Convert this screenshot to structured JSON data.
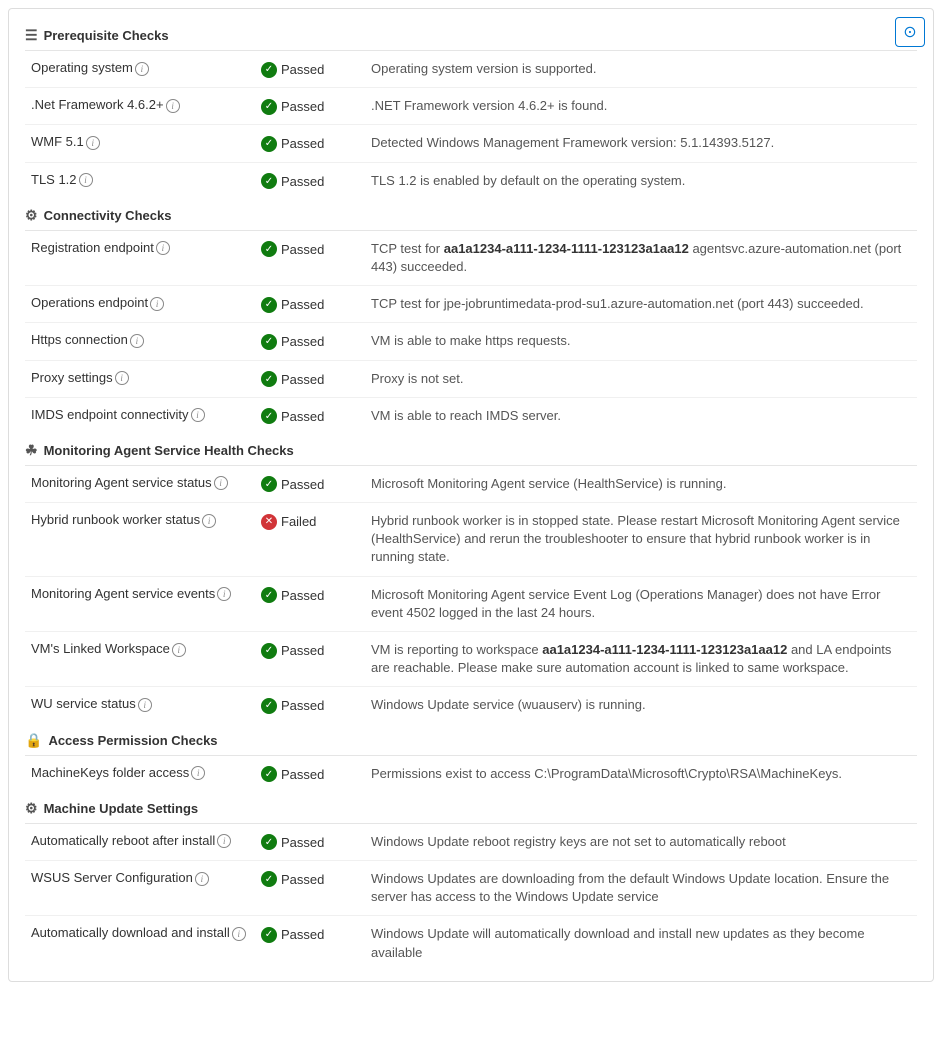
{
  "title": "Prerequisite Checks",
  "capture_button_label": "📷",
  "sections": [
    {
      "id": "prerequisite",
      "icon": "≡",
      "label": "Prerequisite Checks",
      "rows": [
        {
          "name": "Operating system",
          "info": true,
          "status": "Passed",
          "passed": true,
          "description": "Operating system version is supported."
        },
        {
          "name": ".Net Framework 4.6.2+",
          "info": true,
          "status": "Passed",
          "passed": true,
          "description": ".NET Framework version 4.6.2+ is found."
        },
        {
          "name": "WMF 5.1",
          "info": true,
          "status": "Passed",
          "passed": true,
          "description": "Detected Windows Management Framework version: 5.1.14393.5127."
        },
        {
          "name": "TLS 1.2",
          "info": true,
          "status": "Passed",
          "passed": true,
          "description": "TLS 1.2 is enabled by default on the operating system."
        }
      ]
    },
    {
      "id": "connectivity",
      "icon": "🔗",
      "label": "Connectivity Checks",
      "rows": [
        {
          "name": "Registration endpoint",
          "info": true,
          "status": "Passed",
          "passed": true,
          "description": "TCP test for aa1a1234-a111-1234-1111-123123a1aa12 agentsvc.azure-automation.net (port 443) succeeded.",
          "boldParts": [
            "aa1a1234-a111-1234-1111-123123a1aa12"
          ]
        },
        {
          "name": "Operations endpoint",
          "info": true,
          "status": "Passed",
          "passed": true,
          "description": "TCP test for jpe-jobruntimedata-prod-su1.azure-automation.net (port 443) succeeded."
        },
        {
          "name": "Https connection",
          "info": true,
          "status": "Passed",
          "passed": true,
          "description": "VM is able to make https requests."
        },
        {
          "name": "Proxy settings",
          "info": true,
          "status": "Passed",
          "passed": true,
          "description": "Proxy is not set."
        },
        {
          "name": "IMDS endpoint connectivity",
          "info": true,
          "status": "Passed",
          "passed": true,
          "description": "VM is able to reach IMDS server."
        }
      ]
    },
    {
      "id": "monitoring",
      "icon": "⚙",
      "label": "Monitoring Agent Service Health Checks",
      "rows": [
        {
          "name": "Monitoring Agent service status",
          "info": true,
          "status": "Passed",
          "passed": true,
          "description": "Microsoft Monitoring Agent service (HealthService) is running."
        },
        {
          "name": "Hybrid runbook worker status",
          "info": true,
          "status": "Failed",
          "passed": false,
          "description": "Hybrid runbook worker is in stopped state. Please restart Microsoft Monitoring Agent service (HealthService) and rerun the troubleshooter to ensure that hybrid runbook worker is in running state."
        },
        {
          "name": "Monitoring Agent service events",
          "info": true,
          "status": "Passed",
          "passed": true,
          "description": "Microsoft Monitoring Agent service Event Log (Operations Manager) does not have Error event 4502 logged in the last 24 hours."
        },
        {
          "name": "VM's Linked Workspace",
          "info": true,
          "status": "Passed",
          "passed": true,
          "description": "VM is reporting to workspace aa1a1234-a111-1234-1111-123123a1aa12 and LA endpoints are reachable. Please make sure automation account is linked to same workspace.",
          "boldParts": [
            "aa1a1234-a111-1234-1111-123123a1aa12"
          ]
        },
        {
          "name": "WU service status",
          "info": true,
          "status": "Passed",
          "passed": true,
          "description": "Windows Update service (wuauserv) is running."
        }
      ]
    },
    {
      "id": "access",
      "icon": "🔒",
      "label": "Access Permission Checks",
      "rows": [
        {
          "name": "MachineKeys folder access",
          "info": true,
          "status": "Passed",
          "passed": true,
          "description": "Permissions exist to access C:\\ProgramData\\Microsoft\\Crypto\\RSA\\MachineKeys."
        }
      ]
    },
    {
      "id": "machineupdate",
      "icon": "⚙",
      "label": "Machine Update Settings",
      "rows": [
        {
          "name": "Automatically reboot after install",
          "info": true,
          "status": "Passed",
          "passed": true,
          "description": "Windows Update reboot registry keys are not set to automatically reboot"
        },
        {
          "name": "WSUS Server Configuration",
          "info": true,
          "status": "Passed",
          "passed": true,
          "description": "Windows Updates are downloading from the default Windows Update location. Ensure the server has access to the Windows Update service"
        },
        {
          "name": "Automatically download and install",
          "info": true,
          "status": "Passed",
          "passed": true,
          "description": "Windows Update will automatically download and install new updates as they become available"
        }
      ]
    }
  ]
}
